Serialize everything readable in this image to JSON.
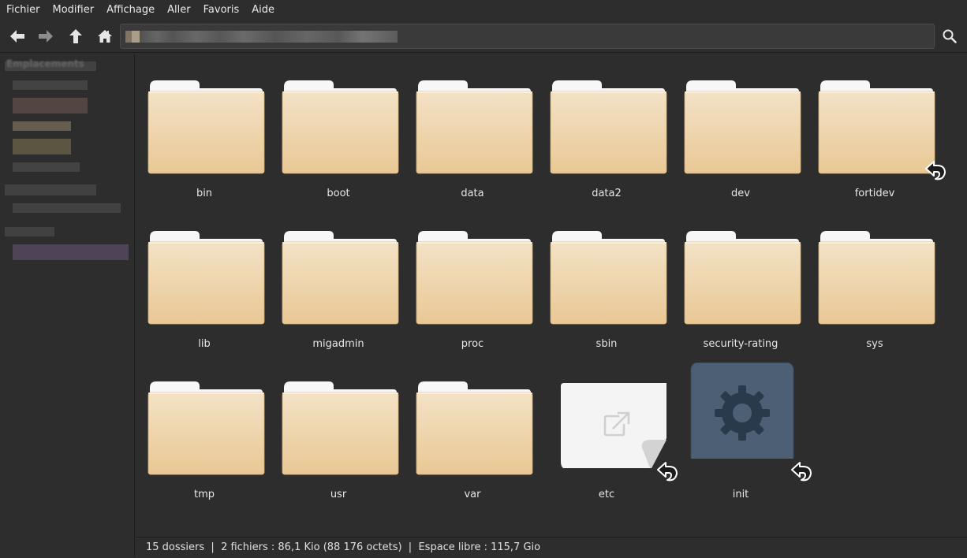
{
  "menubar": {
    "items": [
      "Fichier",
      "Modifier",
      "Affichage",
      "Aller",
      "Favoris",
      "Aide"
    ]
  },
  "toolbar": {
    "back_icon": "arrow-left-icon",
    "forward_icon": "arrow-right-icon",
    "up_icon": "arrow-up-icon",
    "home_icon": "home-icon",
    "search_icon": "search-icon"
  },
  "sidebar": {
    "heading": "Emplacements"
  },
  "files": [
    {
      "name": "bin",
      "kind": "folder",
      "symlink": false
    },
    {
      "name": "boot",
      "kind": "folder",
      "symlink": false
    },
    {
      "name": "data",
      "kind": "folder",
      "symlink": false
    },
    {
      "name": "data2",
      "kind": "folder",
      "symlink": false
    },
    {
      "name": "dev",
      "kind": "folder",
      "symlink": false
    },
    {
      "name": "fortidev",
      "kind": "folder",
      "symlink": true
    },
    {
      "name": "lib",
      "kind": "folder",
      "symlink": false
    },
    {
      "name": "migadmin",
      "kind": "folder",
      "symlink": false
    },
    {
      "name": "proc",
      "kind": "folder",
      "symlink": false
    },
    {
      "name": "sbin",
      "kind": "folder",
      "symlink": false
    },
    {
      "name": "security-rating",
      "kind": "folder",
      "symlink": false
    },
    {
      "name": "sys",
      "kind": "folder",
      "symlink": false
    },
    {
      "name": "tmp",
      "kind": "folder",
      "symlink": false
    },
    {
      "name": "usr",
      "kind": "folder",
      "symlink": false
    },
    {
      "name": "var",
      "kind": "folder",
      "symlink": false
    },
    {
      "name": "etc",
      "kind": "link-file",
      "symlink": true
    },
    {
      "name": "init",
      "kind": "executable",
      "symlink": true
    }
  ],
  "colors": {
    "background": "#2d2d2d",
    "folder_front_top": "#f3e2c6",
    "folder_front_bottom": "#e9c895",
    "executable": "#4d5f74"
  },
  "statusbar": {
    "text": "15 dossiers  |  2 fichiers : 86,1 Kio (88 176 octets)  |  Espace libre : 115,7 Gio"
  }
}
